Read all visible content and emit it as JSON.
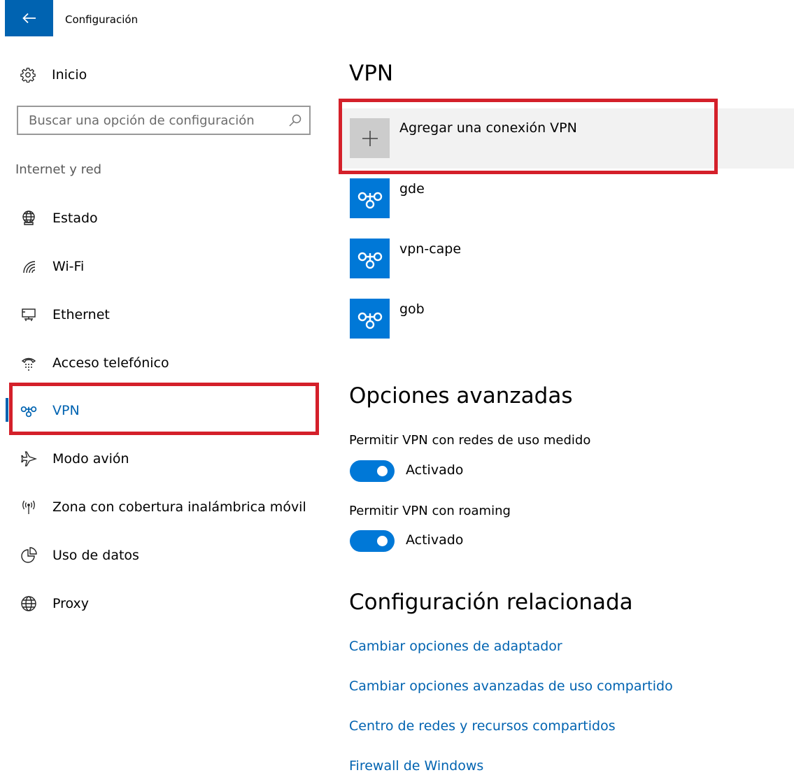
{
  "window": {
    "title": "Configuración"
  },
  "colors": {
    "accent": "#0078d7",
    "highlight": "#d4202a"
  },
  "sidebar": {
    "home_label": "Inicio",
    "search": {
      "placeholder": "Buscar una opción de configuración"
    },
    "section_label": "Internet y red",
    "items": [
      {
        "label": "Estado",
        "icon": "globe-monitor-icon"
      },
      {
        "label": "Wi-Fi",
        "icon": "wifi-icon"
      },
      {
        "label": "Ethernet",
        "icon": "ethernet-icon"
      },
      {
        "label": "Acceso telefónico",
        "icon": "dialup-icon"
      },
      {
        "label": "VPN",
        "icon": "vpn-icon",
        "selected": true
      },
      {
        "label": "Modo avión",
        "icon": "airplane-icon"
      },
      {
        "label": "Zona con cobertura inalámbrica móvil",
        "icon": "hotspot-icon"
      },
      {
        "label": "Uso de datos",
        "icon": "data-usage-icon"
      },
      {
        "label": "Proxy",
        "icon": "globe-icon"
      }
    ]
  },
  "main": {
    "title": "VPN",
    "add_connection_label": "Agregar una conexión VPN",
    "connections": [
      {
        "name": "gde"
      },
      {
        "name": "vpn-cape"
      },
      {
        "name": "gob"
      }
    ],
    "advanced": {
      "title": "Opciones avanzadas",
      "options": [
        {
          "label": "Permitir VPN con redes de uso medido",
          "state": "Activado",
          "on": true
        },
        {
          "label": "Permitir VPN con roaming",
          "state": "Activado",
          "on": true
        }
      ]
    },
    "related": {
      "title": "Configuración relacionada",
      "links": [
        "Cambiar opciones de adaptador",
        "Cambiar opciones avanzadas de uso compartido",
        "Centro de redes y recursos compartidos",
        "Firewall de Windows"
      ]
    }
  }
}
